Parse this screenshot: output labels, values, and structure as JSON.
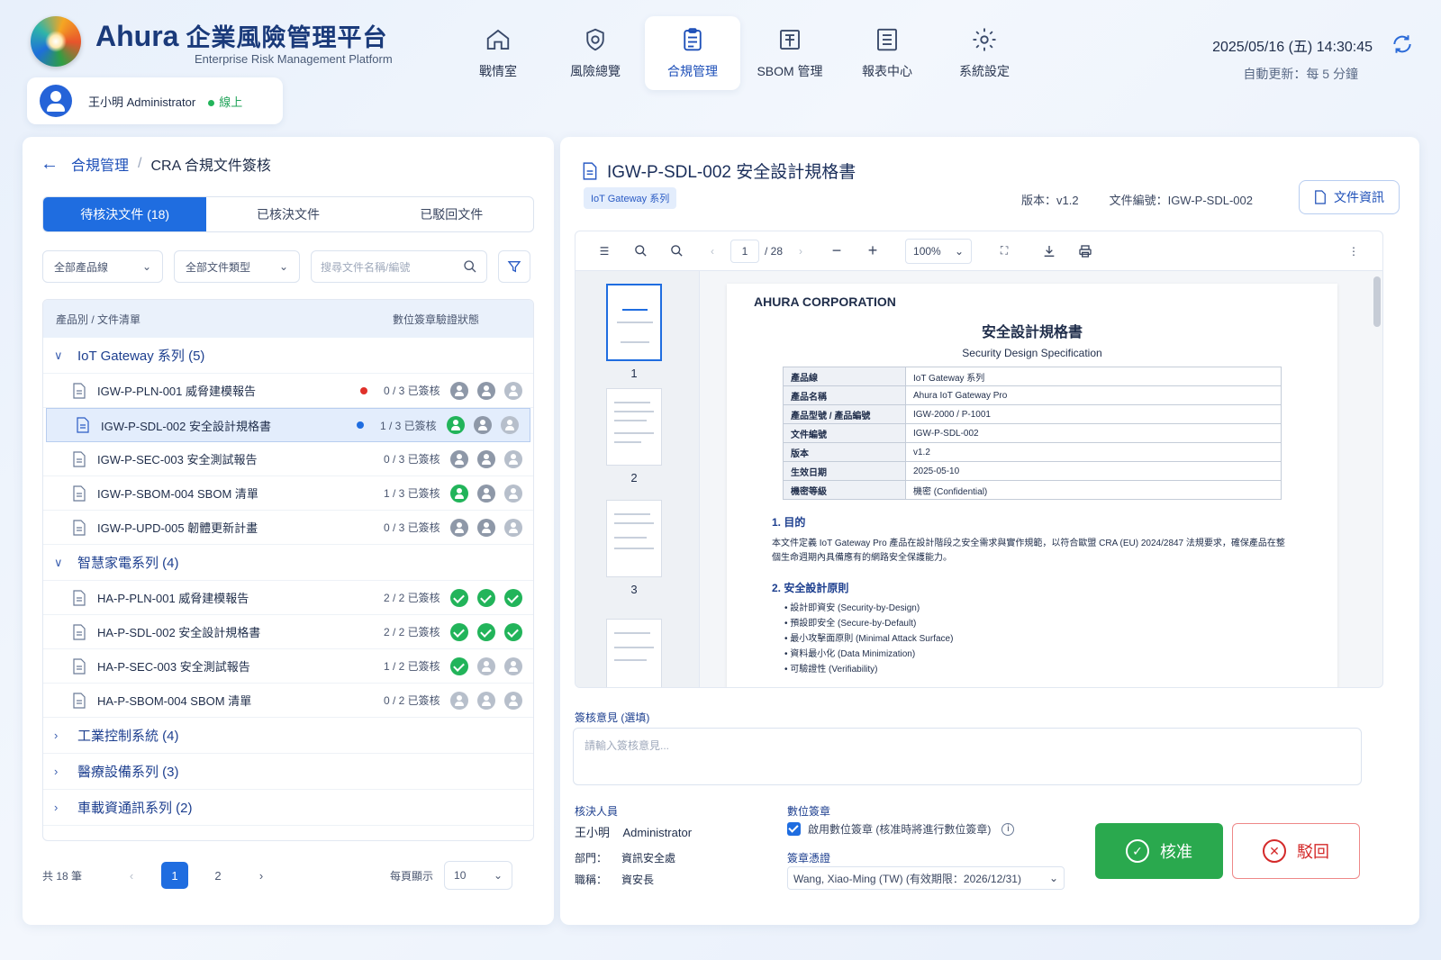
{
  "header": {
    "brand": "Ahura",
    "brand_cn": "企業風險管理平台",
    "brand_sub": "Enterprise Risk Management Platform",
    "user": {
      "name": "王小明  Administrator",
      "status": "線上"
    },
    "nav": [
      {
        "label": "戰情室",
        "icon": "home-icon"
      },
      {
        "label": "風險總覽",
        "icon": "shield-icon"
      },
      {
        "label": "合規管理",
        "icon": "clipboard-icon"
      },
      {
        "label": "SBOM 管理",
        "icon": "sbom-icon"
      },
      {
        "label": "報表中心",
        "icon": "report-icon"
      },
      {
        "label": "系統設定",
        "icon": "gear-icon"
      }
    ],
    "datetime": "2025/05/16 (五) 14:30:45",
    "auto_refresh": "自動更新：每 5 分鐘"
  },
  "left": {
    "breadcrumb": {
      "parent": "合規管理",
      "sep": "/",
      "current": "CRA 合規文件簽核"
    },
    "tabs": [
      "待核決文件 (18)",
      "已核決文件",
      "已駁回文件"
    ],
    "filters": {
      "product": "全部產品線",
      "type": "全部文件類型",
      "search_placeholder": "搜尋文件名稱/編號"
    },
    "list_head": {
      "col1": "產品別 / 文件清單",
      "col2": "數位簽章驗證狀態"
    },
    "groups": [
      {
        "label": "IoT Gateway 系列  (5)",
        "expanded": true
      },
      {
        "label": "智慧家電系列  (4)",
        "expanded": true
      },
      {
        "label": "工業控制系統  (4)",
        "expanded": false
      },
      {
        "label": "醫療設備系列  (3)",
        "expanded": false
      },
      {
        "label": "車載資通訊系列  (2)",
        "expanded": false
      }
    ],
    "rows_a": [
      {
        "title": "IGW-P-PLN-001  威脅建模報告",
        "count": "0 / 3 已簽核"
      },
      {
        "title": "IGW-P-SDL-002  安全設計規格書",
        "count": "1 / 3 已簽核"
      },
      {
        "title": "IGW-P-SEC-003  安全測試報告",
        "count": "0 / 3 已簽核"
      },
      {
        "title": "IGW-P-SBOM-004  SBOM 清單",
        "count": "1 / 3 已簽核"
      },
      {
        "title": "IGW-P-UPD-005  韌體更新計畫",
        "count": "0 / 3 已簽核"
      }
    ],
    "rows_b": [
      {
        "title": "HA-P-PLN-001  威脅建模報告",
        "count": "2 / 2 已簽核"
      },
      {
        "title": "HA-P-SDL-002  安全設計規格書",
        "count": "2 / 2 已簽核"
      },
      {
        "title": "HA-P-SEC-003  安全測試報告",
        "count": "1 / 2 已簽核"
      },
      {
        "title": "HA-P-SBOM-004  SBOM 清單",
        "count": "0 / 2 已簽核"
      }
    ],
    "pager": {
      "total": "共 18 筆",
      "pages": [
        "1",
        "2"
      ],
      "per_page_label": "每頁顯示",
      "per_page": "10"
    }
  },
  "doc": {
    "title": "IGW-P-SDL-002  安全設計規格書",
    "badge": "IoT Gateway 系列",
    "version": "版本：v1.2",
    "doc_no": "文件編號：IGW-P-SDL-002",
    "info_btn": "文件資訊",
    "page_current": "1",
    "page_total": "/ 28",
    "zoom": "100%",
    "thumb_nums": [
      "1",
      "2",
      "3"
    ],
    "content": {
      "corp": "AHURA CORPORATION",
      "title": "安全設計規格書",
      "subtitle": "Security Design Specification",
      "table": [
        [
          "產品線",
          "IoT Gateway 系列"
        ],
        [
          "產品名稱",
          "Ahura IoT Gateway Pro"
        ],
        [
          "產品型號 / 產品編號",
          "IGW-2000 / P-1001"
        ],
        [
          "文件編號",
          "IGW-P-SDL-002"
        ],
        [
          "版本",
          "v1.2"
        ],
        [
          "生效日期",
          "2025-05-10"
        ],
        [
          "機密等級",
          "機密 (Confidential)"
        ]
      ],
      "s1": "1.  目的",
      "s1_text": "本文件定義 IoT Gateway Pro 產品在設計階段之安全需求與實作規範，以符合歐盟 CRA (EU) 2024/2847 法規要求，確保產品在整個生命週期內具備應有的網路安全保護能力。",
      "s2": "2.  安全設計原則",
      "bullets": [
        "設計即資安 (Security-by-Design)",
        "預設即安全 (Secure-by-Default)",
        "最小攻擊面原則 (Minimal Attack Surface)",
        "資料最小化 (Data Minimization)",
        "可驗證性 (Verifiability)"
      ]
    }
  },
  "review": {
    "comment_label": "簽核意見 (選填)",
    "comment_placeholder": "請輸入簽核意見...",
    "reviewer_label": "核決人員",
    "reviewer": "王小明    Administrator",
    "dept_label": "部門：",
    "dept": "資訊安全處",
    "role_label": "職稱：",
    "role": "資安長",
    "sig_label": "數位簽章",
    "sig_check": "啟用數位簽章  (核准時將進行數位簽章)",
    "cert_label": "簽章憑證",
    "cert": "Wang, Xiao-Ming (TW)  (有效期限：2026/12/31)",
    "approve": "核准",
    "reject": "駁回"
  }
}
